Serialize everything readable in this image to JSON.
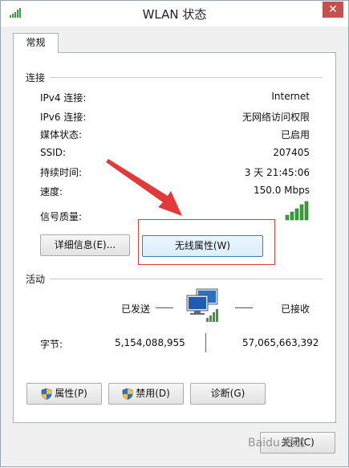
{
  "window": {
    "title": "WLAN 状态",
    "close_glyph": "✕"
  },
  "tabs": [
    {
      "label": "常规"
    }
  ],
  "connection": {
    "section_label": "连接",
    "rows": [
      {
        "label": "IPv4 连接:",
        "value": "Internet"
      },
      {
        "label": "IPv6 连接:",
        "value": "无网络访问权限"
      },
      {
        "label": "媒体状态:",
        "value": "已启用"
      },
      {
        "label": "SSID:",
        "value": "207405"
      },
      {
        "label": "持续时间:",
        "value": "3 天 21:45:06"
      },
      {
        "label": "速度:",
        "value": "150.0 Mbps"
      }
    ],
    "signal_label": "信号质量:",
    "signal_bars_filled": 5,
    "signal_bars_total": 5,
    "details_button": "详细信息(E)...",
    "wireless_props_button": "无线属性(W)"
  },
  "activity": {
    "section_label": "活动",
    "sent_label": "已发送",
    "received_label": "已接收",
    "bytes_label": "字节:",
    "bytes_sent": "5,154,088,955",
    "bytes_received": "57,065,663,392"
  },
  "buttons": {
    "properties": "属性(P)",
    "disable": "禁用(D)",
    "diagnose": "诊断(G)",
    "close": "关闭(C)"
  },
  "watermark": {
    "text": "Baidu 经验"
  },
  "colors": {
    "highlight_rect": "#d64545",
    "arrow": "#e23a3a",
    "signal_green": "#3a9c3a",
    "close_red": "#c7504c"
  }
}
